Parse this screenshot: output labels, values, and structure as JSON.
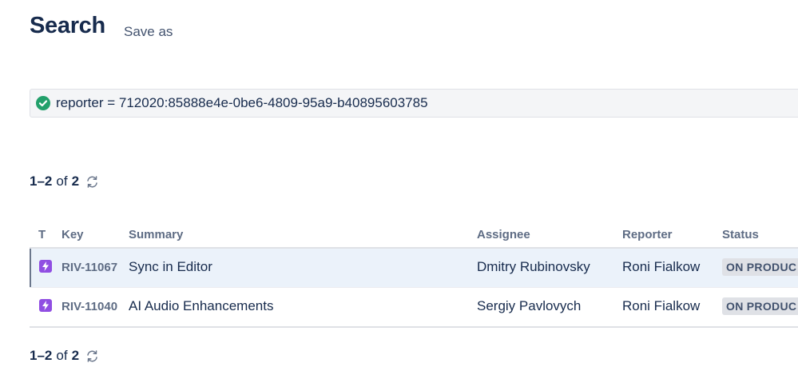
{
  "header": {
    "title": "Search",
    "save_as_label": "Save as"
  },
  "jql": {
    "query": "reporter = 712020:85888e4e-0be6-4809-95a9-b40895603785",
    "status_icon": "check-circle-icon",
    "status_color": "#22a06b"
  },
  "pagination": {
    "range": "1–2",
    "of_label": "of",
    "total": "2",
    "refresh_icon": "refresh-icon"
  },
  "table": {
    "columns": {
      "type": "T",
      "key": "Key",
      "summary": "Summary",
      "assignee": "Assignee",
      "reporter": "Reporter",
      "status": "Status"
    },
    "rows": [
      {
        "type_icon": "epic-lightning-icon",
        "key": "RIV-11067",
        "summary": "Sync in Editor",
        "assignee": "Dmitry Rubinovsky",
        "reporter": "Roni Fialkow",
        "status": "ON PRODUC"
      },
      {
        "type_icon": "epic-lightning-icon",
        "key": "RIV-11040",
        "summary": "AI Audio Enhancements",
        "assignee": "Sergiy Pavlovych",
        "reporter": "Roni Fialkow",
        "status": "ON PRODUC"
      }
    ]
  },
  "colors": {
    "epic": "#904ee2",
    "selected_row": "#ebf2fa",
    "text": "#172b4d"
  }
}
